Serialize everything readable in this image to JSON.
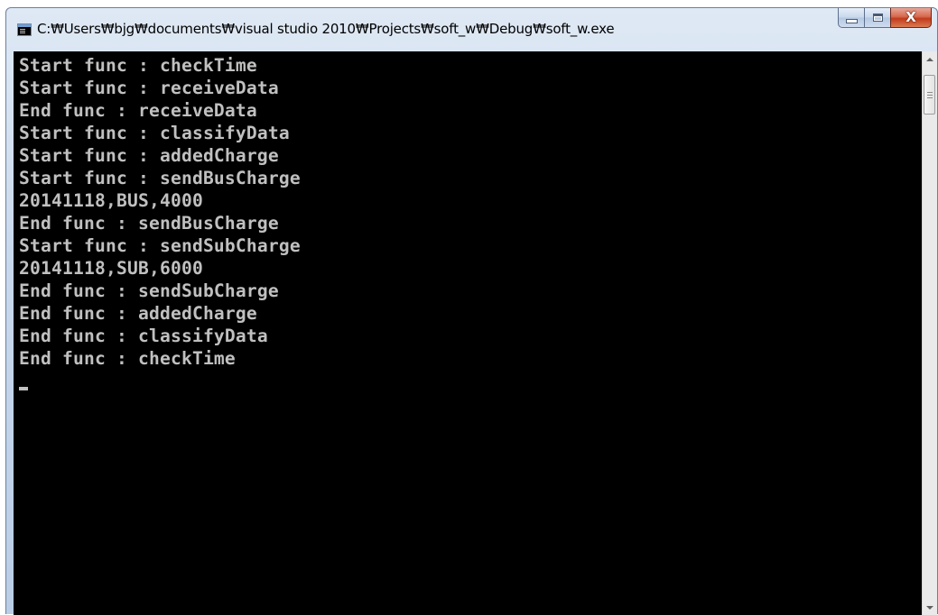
{
  "window": {
    "title": "C:₩Users₩bjg₩documents₩visual studio 2010₩Projects₩soft_w₩Debug₩soft_w.exe",
    "icon": "console-app-icon",
    "controls": {
      "minimize": "minimize-icon",
      "maximize": "maximize-icon",
      "close": "close-icon",
      "close_glyph": "X"
    }
  },
  "console": {
    "lines": [
      "Start func : checkTime",
      "Start func : receiveData",
      "End func : receiveData",
      "Start func : classifyData",
      "Start func : addedCharge",
      "Start func : sendBusCharge",
      "20141118,BUS,4000",
      "End func : sendBusCharge",
      "Start func : sendSubCharge",
      "20141118,SUB,6000",
      "End func : sendSubCharge",
      "End func : addedCharge",
      "End func : classifyData",
      "End func : checkTime"
    ],
    "text_color": "#c0c0c0",
    "background": "#000000"
  },
  "scrollbar": {
    "up_icon": "scroll-up-arrow-icon",
    "down_icon": "scroll-down-arrow-icon"
  }
}
